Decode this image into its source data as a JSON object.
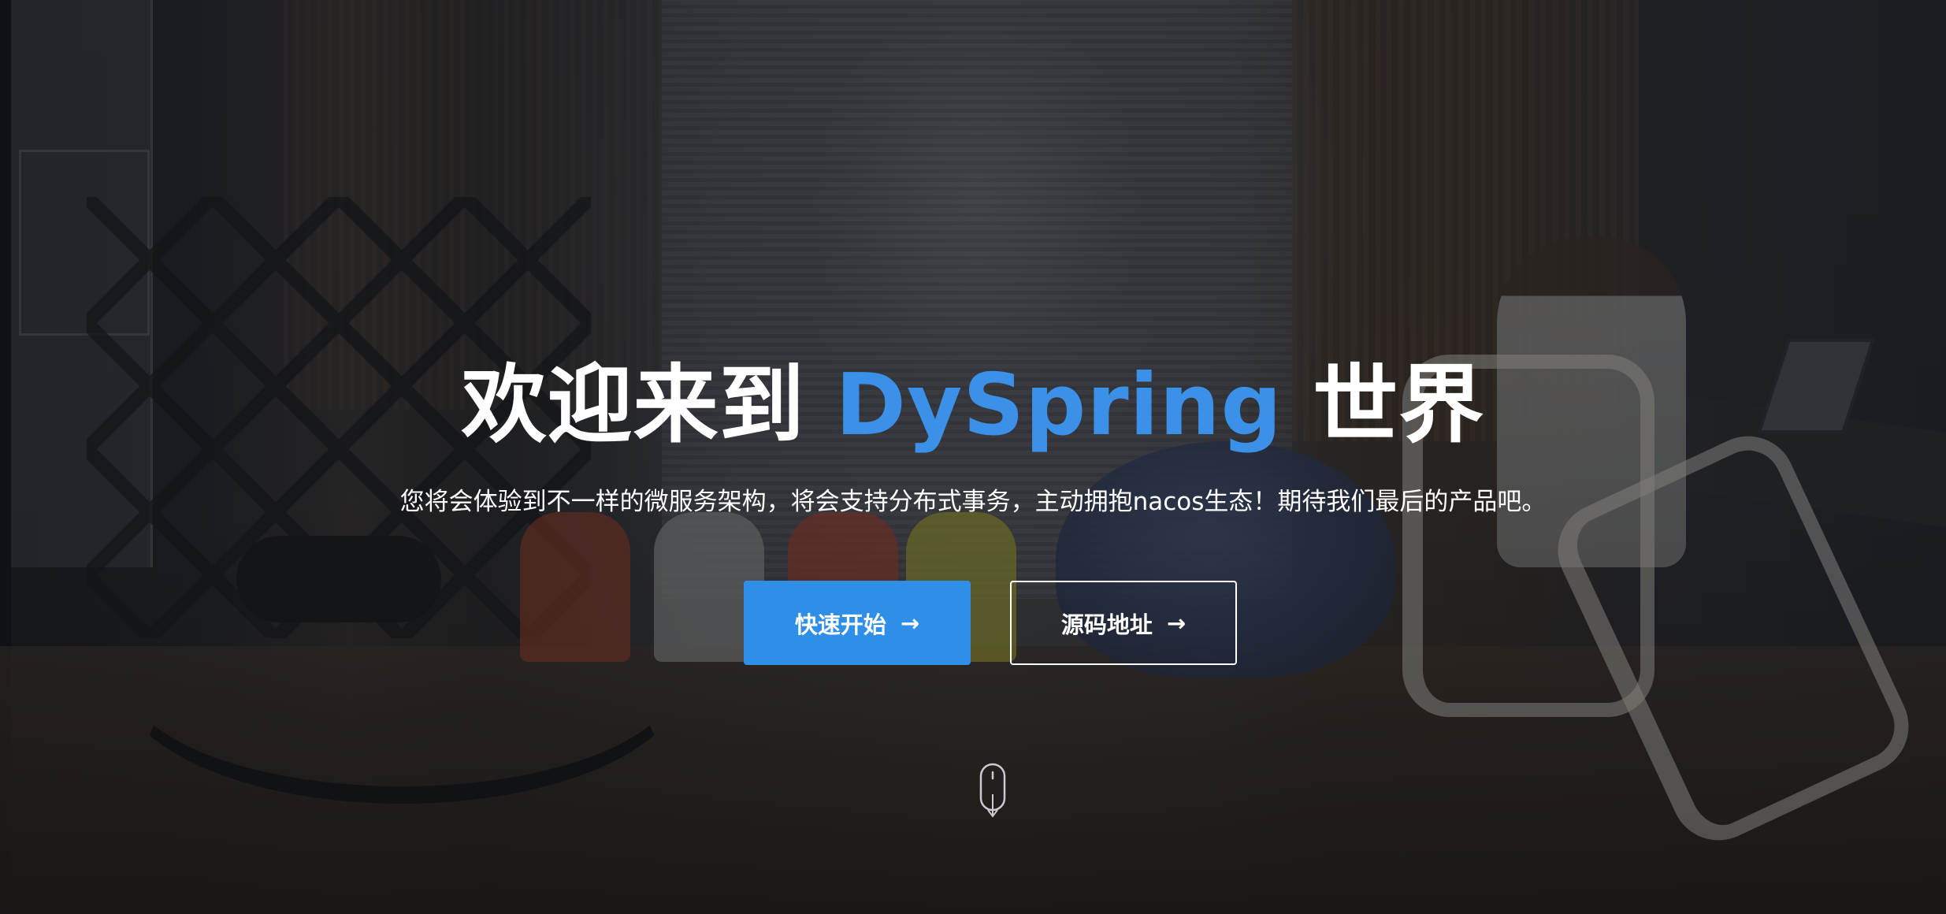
{
  "hero": {
    "title_prefix": "欢迎来到 ",
    "title_highlight": "DySpring",
    "title_suffix": " 世界",
    "subtitle": "您将会体验到不一样的微服务架构，将会支持分布式事务，主动拥抱nacos生态！期待我们最后的产品吧。",
    "accent_color": "#3b90e8"
  },
  "buttons": {
    "primary_label": "快速开始",
    "primary_icon": "→",
    "secondary_label": "源码地址",
    "secondary_icon": "→"
  },
  "scroll_icon": "mouse-scroll-icon"
}
